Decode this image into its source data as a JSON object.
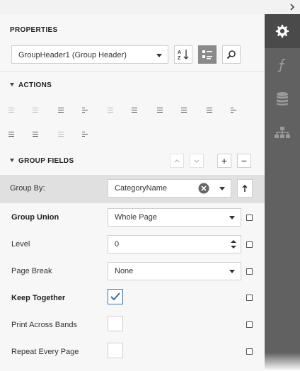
{
  "panel": {
    "title": "PROPERTIES"
  },
  "selector": {
    "value": "GroupHeader1 (Group Header)"
  },
  "actions": {
    "title": "ACTIONS"
  },
  "group_fields": {
    "title": "GROUP FIELDS"
  },
  "group_by": {
    "label": "Group By:",
    "value": "CategoryName"
  },
  "properties": {
    "group_union": {
      "label": "Group Union",
      "value": "Whole Page"
    },
    "level": {
      "label": "Level",
      "value": "0"
    },
    "page_break": {
      "label": "Page Break",
      "value": "None"
    },
    "keep_together": {
      "label": "Keep Together",
      "checked": true
    },
    "print_across_bands": {
      "label": "Print Across Bands",
      "checked": false
    },
    "repeat_every_page": {
      "label": "Repeat Every Page",
      "checked": false
    }
  },
  "buttons": {
    "plus": "+",
    "minus": "−"
  },
  "colors": {
    "sidebar": "#616161",
    "sidebar_active": "#4a4a4a",
    "checkbox_accent": "#3a6ea5"
  }
}
